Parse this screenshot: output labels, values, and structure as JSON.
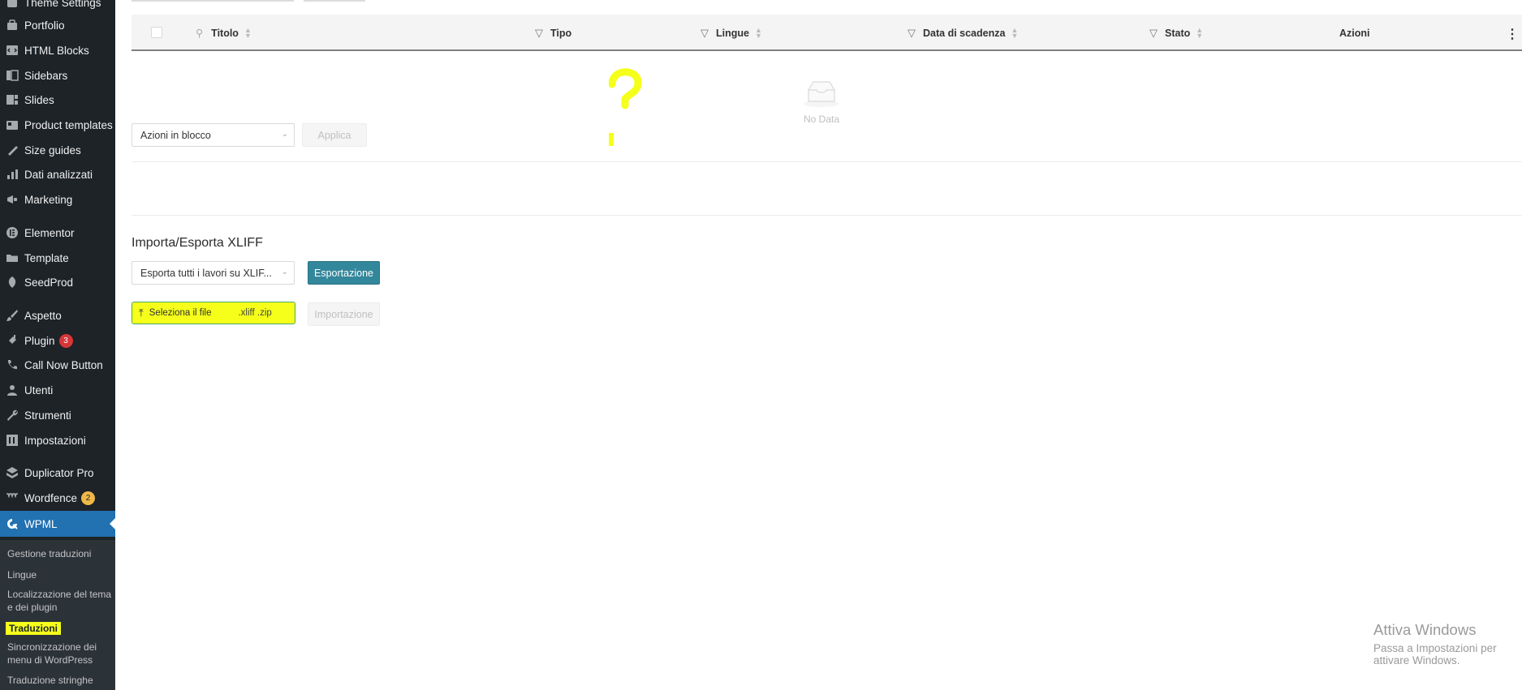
{
  "sidebar": {
    "items": [
      {
        "label": "Theme Settings",
        "icon": "theme-icon"
      },
      {
        "label": "Portfolio",
        "icon": "portfolio-icon"
      },
      {
        "label": "HTML Blocks",
        "icon": "code-icon"
      },
      {
        "label": "Sidebars",
        "icon": "sidebar-icon"
      },
      {
        "label": "Slides",
        "icon": "slides-icon"
      },
      {
        "label": "Product templates",
        "icon": "product-template-icon"
      },
      {
        "label": "Size guides",
        "icon": "ruler-icon"
      },
      {
        "label": "Dati analizzati",
        "icon": "chart-icon"
      },
      {
        "label": "Marketing",
        "icon": "megaphone-icon"
      },
      {
        "label": "Elementor",
        "icon": "elementor-icon"
      },
      {
        "label": "Template",
        "icon": "folder-icon"
      },
      {
        "label": "SeedProd",
        "icon": "seedprod-icon"
      },
      {
        "label": "Aspetto",
        "icon": "brush-icon"
      },
      {
        "label": "Plugin",
        "icon": "plugin-icon",
        "badge": "3"
      },
      {
        "label": "Call Now Button",
        "icon": "phone-icon"
      },
      {
        "label": "Utenti",
        "icon": "user-icon"
      },
      {
        "label": "Strumenti",
        "icon": "wrench-icon"
      },
      {
        "label": "Impostazioni",
        "icon": "settings-icon"
      },
      {
        "label": "Duplicator Pro",
        "icon": "duplicator-icon"
      },
      {
        "label": "Wordfence",
        "icon": "wordfence-icon",
        "badge": "2"
      },
      {
        "label": "WPML",
        "icon": "wpml-icon"
      }
    ],
    "submenu": [
      {
        "label": "Gestione traduzioni"
      },
      {
        "label": "Lingue"
      },
      {
        "label": "Localizzazione del tema e dei plugin"
      },
      {
        "label": "Traduzioni"
      },
      {
        "label": "Sincronizzazione dei menu di WordPress"
      },
      {
        "label": "Traduzione stringhe"
      }
    ]
  },
  "table": {
    "columns": {
      "title": "Titolo",
      "type": "Tipo",
      "languages": "Lingue",
      "deadline": "Data di scadenza",
      "status": "Stato",
      "actions": "Azioni"
    },
    "empty_text": "No Data"
  },
  "bulk": {
    "select_value": "Azioni in blocco",
    "apply_label": "Applica"
  },
  "xliff": {
    "title": "Importa/Esporta XLIFF",
    "export_select_value": "Esporta tutti i lavori su XLIF...",
    "export_button": "Esportazione",
    "upload_label": "Seleziona il file",
    "upload_ext": ".xliff .zip",
    "import_button": "Importazione"
  },
  "watermark": {
    "line1": "Attiva Windows",
    "line2": "Passa a Impostazioni per attivare Windows."
  },
  "colors": {
    "sidebar_bg": "#1d2327",
    "active_menu": "#2271b1",
    "primary_button": "#33879b",
    "highlight": "#f5ff1a"
  }
}
